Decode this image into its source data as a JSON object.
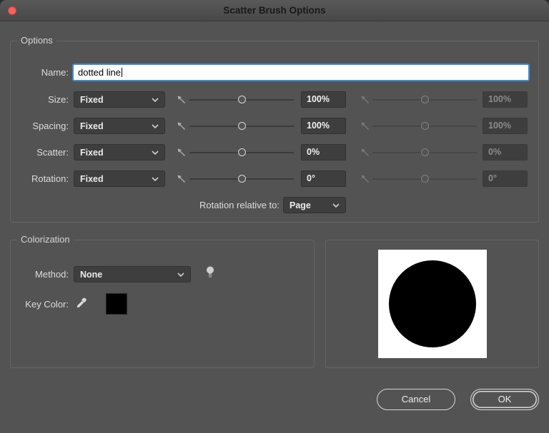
{
  "dialog": {
    "title": "Scatter Brush Options"
  },
  "options": {
    "legend": "Options",
    "name": {
      "label": "Name:",
      "value": "dotted line"
    },
    "rows": [
      {
        "label": "Size:",
        "mode": "Fixed",
        "value": "100%",
        "value2": "100%"
      },
      {
        "label": "Spacing:",
        "mode": "Fixed",
        "value": "100%",
        "value2": "100%"
      },
      {
        "label": "Scatter:",
        "mode": "Fixed",
        "value": "0%",
        "value2": "0%"
      },
      {
        "label": "Rotation:",
        "mode": "Fixed",
        "value": "0°",
        "value2": "0°"
      }
    ],
    "rotation_relative": {
      "label": "Rotation relative to:",
      "value": "Page"
    }
  },
  "colorization": {
    "legend": "Colorization",
    "method": {
      "label": "Method:",
      "value": "None"
    },
    "key_color": {
      "label": "Key Color:",
      "color": "#000000"
    }
  },
  "preview": {
    "shape": "circle",
    "background": "#ffffff",
    "shape_color": "#000000"
  },
  "buttons": {
    "cancel": "Cancel",
    "ok": "OK"
  },
  "icons": {
    "close": "close-icon",
    "dropdown_chevron": "chevron-down-icon",
    "slider": "diagonal-slider-icon",
    "tips": "lightbulb-icon",
    "eyedropper": "eyedropper-icon"
  },
  "colors": {
    "close_button": "#ff5f57",
    "focus_ring": "#3f8cd6",
    "key_color": "#000000"
  }
}
